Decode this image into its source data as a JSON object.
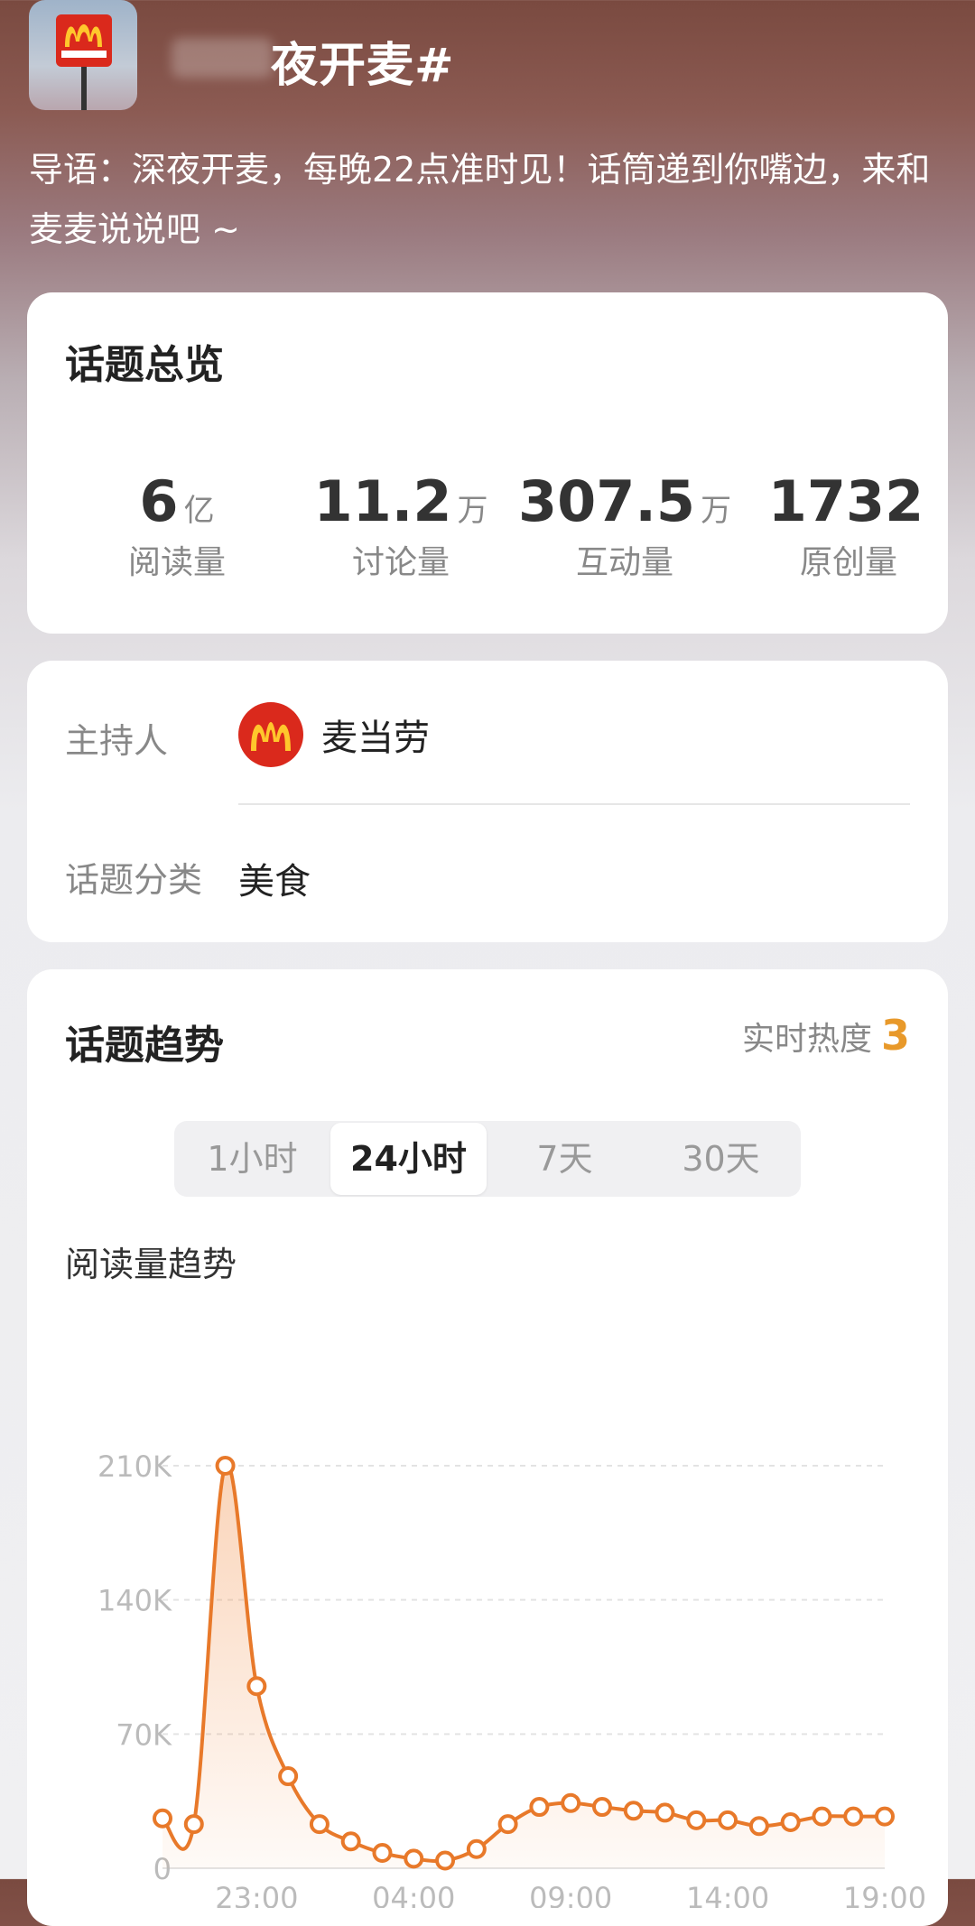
{
  "header": {
    "title": "夜开麦#",
    "description": "导语：深夜开麦，每晚22点准时见！话筒递到你嘴边，来和麦麦说说吧 ~"
  },
  "overview": {
    "title": "话题总览",
    "stats": [
      {
        "value": "6",
        "unit": "亿",
        "label": "阅读量"
      },
      {
        "value": "11.2",
        "unit": "万",
        "label": "讨论量"
      },
      {
        "value": "307.5",
        "unit": "万",
        "label": "互动量"
      },
      {
        "value": "1732",
        "unit": "",
        "label": "原创量"
      }
    ]
  },
  "info": {
    "host_label": "主持人",
    "host_name": "麦当劳",
    "category_label": "话题分类",
    "category_value": "美食"
  },
  "trend": {
    "title": "话题趋势",
    "realtime_label": "实时热度",
    "realtime_value": "3",
    "tabs": [
      "1小时",
      "24小时",
      "7天",
      "30天"
    ],
    "active_tab": "24小时",
    "chart_title": "阅读量趋势"
  },
  "colors": {
    "accent": "#e8792a",
    "mcd_red": "#da291c",
    "mcd_yellow": "#ffc72c"
  },
  "chart_data": {
    "type": "area",
    "title": "阅读量趋势",
    "y_ticks": [
      "210K",
      "140K",
      "70K",
      "0"
    ],
    "y_tick_values": [
      210000,
      140000,
      70000,
      0
    ],
    "x_tick_labels": [
      "23:00",
      "04:00",
      "09:00",
      "14:00",
      "19:00"
    ],
    "x_tick_indices": [
      3,
      8,
      13,
      18,
      23
    ],
    "ylim": [
      0,
      210000
    ],
    "grid": true,
    "series": [
      {
        "values": [
          26000,
          23000,
          210000,
          95000,
          48000,
          23000,
          14000,
          8000,
          5000,
          4000,
          10000,
          23000,
          32000,
          34000,
          32000,
          30000,
          29000,
          25000,
          25000,
          22000,
          24000,
          27000,
          27000,
          27000
        ]
      }
    ]
  }
}
